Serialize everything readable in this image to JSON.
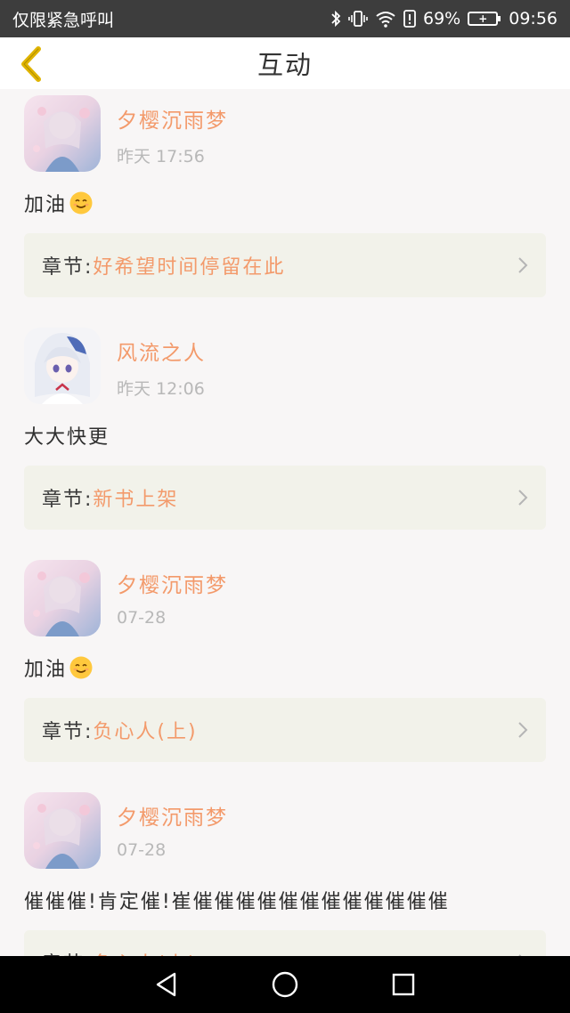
{
  "status_bar": {
    "carrier_text": "仅限紧急呼叫",
    "battery_percent": "69%",
    "time": "09:56",
    "icons": [
      "bluetooth-icon",
      "vibrate-icon",
      "wifi-icon",
      "alert-icon",
      "battery-icon"
    ]
  },
  "header": {
    "title": "互动",
    "back_icon": "chevron-left-icon"
  },
  "colors": {
    "accent": "#f39a6b",
    "back_arrow": "#e0b400",
    "chapter_bg": "#f2f2ea",
    "page_bg": "#f8f6f6"
  },
  "chapter_label": "章节:",
  "items": [
    {
      "name": "夕樱沉雨梦",
      "time": "昨天 17:56",
      "comment": "加油",
      "has_emoji": true,
      "chapter": "好希望时间停留在此",
      "avatar": "pink-anime-avatar"
    },
    {
      "name": "风流之人",
      "time": "昨天 12:06",
      "comment": "大大快更",
      "has_emoji": false,
      "chapter": "新书上架",
      "avatar": "white-hair-anime-avatar"
    },
    {
      "name": "夕樱沉雨梦",
      "time": "07-28",
      "comment": "加油",
      "has_emoji": true,
      "chapter": "负心人(上)",
      "avatar": "pink-anime-avatar"
    },
    {
      "name": "夕樱沉雨梦",
      "time": "07-28",
      "comment": "催催催!肯定催!崔催催催催催催催催催催催催",
      "has_emoji": false,
      "chapter": "负心人(上)",
      "avatar": "pink-anime-avatar"
    }
  ],
  "nav_bar": {
    "icons": [
      "back-triangle-icon",
      "home-circle-icon",
      "recents-square-icon"
    ]
  }
}
